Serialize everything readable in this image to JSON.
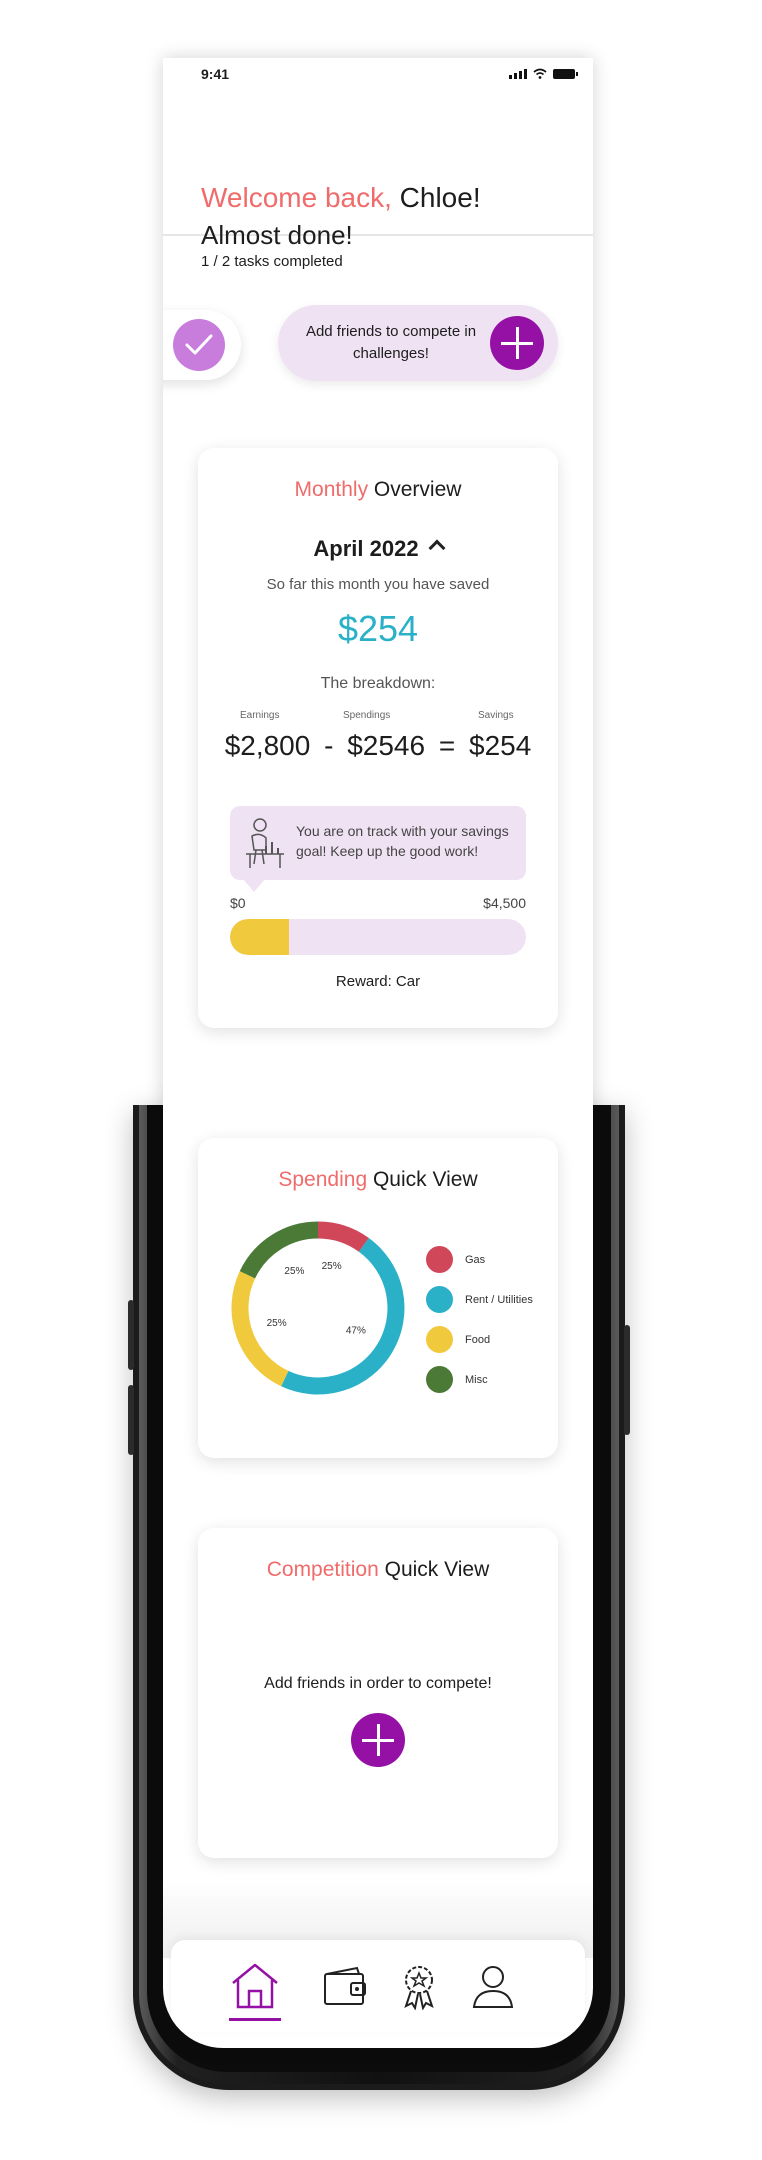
{
  "status_bar": {
    "time": "9:41"
  },
  "header": {
    "welcome_prefix": "Welcome back,",
    "user_name": "Chloe!"
  },
  "tasks": {
    "title": "Almost done!",
    "progress": "1 / 2 tasks completed",
    "pending_task": "Add friends to compete in challenges!"
  },
  "monthly": {
    "title_accent": "Monthly",
    "title_rest": "Overview",
    "month": "April 2022",
    "saved_label": "So far this month you have saved",
    "saved_amount": "$254",
    "breakdown_label": "The breakdown:",
    "earnings_label": "Earnings",
    "spendings_label": "Spendings",
    "savings_label": "Savings",
    "earnings": "$2,800",
    "minus": "-",
    "spendings": "$2546",
    "equals": "=",
    "savings": "$254",
    "tip": "You are on track with your savings goal! Keep up the good work!",
    "range_min": "$0",
    "range_max": "$4,500",
    "progress_fraction": 0.2,
    "reward": "Reward: Car"
  },
  "spending": {
    "title_accent": "Spending",
    "title_rest": "Quick View"
  },
  "chart_data": {
    "type": "pie",
    "categories": [
      "Gas",
      "Rent / Utilities",
      "Food",
      "Misc"
    ],
    "values": [
      10,
      47,
      25,
      18
    ],
    "labels": [
      "25%",
      "47%",
      "25%",
      "25%"
    ],
    "colors": [
      "#d0475a",
      "#2ab1c8",
      "#f0c93c",
      "#4a7a36"
    ]
  },
  "competition": {
    "title_accent": "Competition",
    "title_rest": "Quick View",
    "message": "Add friends in order to compete!"
  },
  "colors": {
    "accent": "#f06b6b",
    "purple": "#9511a6",
    "teal": "#2ab1c8",
    "yellow": "#f0c93c"
  },
  "nav": {
    "items": [
      "home-icon",
      "wallet-icon",
      "award-icon",
      "profile-icon"
    ],
    "active": "home-icon"
  }
}
